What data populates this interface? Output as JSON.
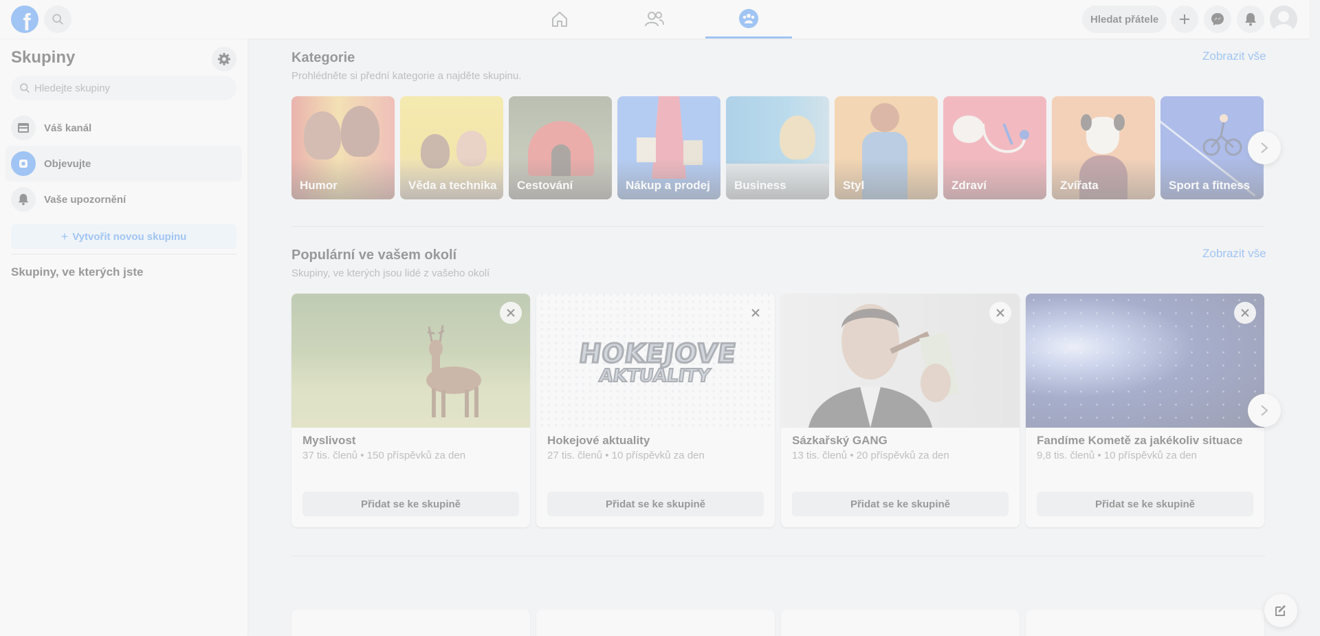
{
  "topbar": {
    "logo_letter": "f",
    "find_friends_label": "Hledat přátele",
    "nav_icons": [
      "home-icon",
      "friends-icon",
      "groups-icon"
    ],
    "right_icons": [
      "plus-icon",
      "messenger-icon",
      "bell-icon",
      "avatar"
    ],
    "accent": "#1877f2"
  },
  "sidebar": {
    "title": "Skupiny",
    "search_placeholder": "Hledejte skupiny",
    "items": [
      {
        "label": "Váš kanál",
        "icon": "feed-icon"
      },
      {
        "label": "Objevujte",
        "icon": "discover-icon"
      },
      {
        "label": "Vaše upozornění",
        "icon": "bell-icon"
      }
    ],
    "create_label": "Vytvořit novou skupinu",
    "joined_title": "Skupiny, ve kterých jste"
  },
  "categories": {
    "title": "Kategorie",
    "subtitle": "Prohlédněte si přední kategorie a najděte skupinu.",
    "see_all": "Zobrazit vše",
    "items": [
      {
        "label": "Humor",
        "bg": "#e0574a"
      },
      {
        "label": "Věda a technika",
        "bg": "#f2d33b"
      },
      {
        "label": "Cestování",
        "bg": "#6f7a55"
      },
      {
        "label": "Nákup a prodej",
        "bg": "#4f8cf0"
      },
      {
        "label": "Business",
        "bg": "#4aa3d8"
      },
      {
        "label": "Styl",
        "bg": "#f2a64a"
      },
      {
        "label": "Zdraví",
        "bg": "#ee5d6c"
      },
      {
        "label": "Zvířata",
        "bg": "#f19a5a"
      },
      {
        "label": "Sport a fitness",
        "bg": "#3b63d6"
      }
    ]
  },
  "popular": {
    "title": "Populární ve vašem okolí",
    "subtitle": "Skupiny, ve kterých jsou lidé z vašeho okolí",
    "see_all": "Zobrazit vše",
    "groups": [
      {
        "name": "Myslivost",
        "meta": "37 tis. členů • 150 příspěvků za den",
        "join": "Přidat se ke skupině"
      },
      {
        "name": "Hokejové aktuality",
        "meta": "27 tis. členů • 10 příspěvků za den",
        "join": "Přidat se ke skupině",
        "logo_line1": "HOKEJOVE",
        "logo_line2": "AKTUALITY"
      },
      {
        "name": "Sázkařský GANG",
        "meta": "13 tis. členů • 20 příspěvků za den",
        "join": "Přidat se ke skupině"
      },
      {
        "name": "Fandíme Kometě za jakékoliv situace",
        "meta": "9,8 tis. členů • 10 příspěvků za den",
        "join": "Přidat se ke skupině"
      }
    ]
  }
}
